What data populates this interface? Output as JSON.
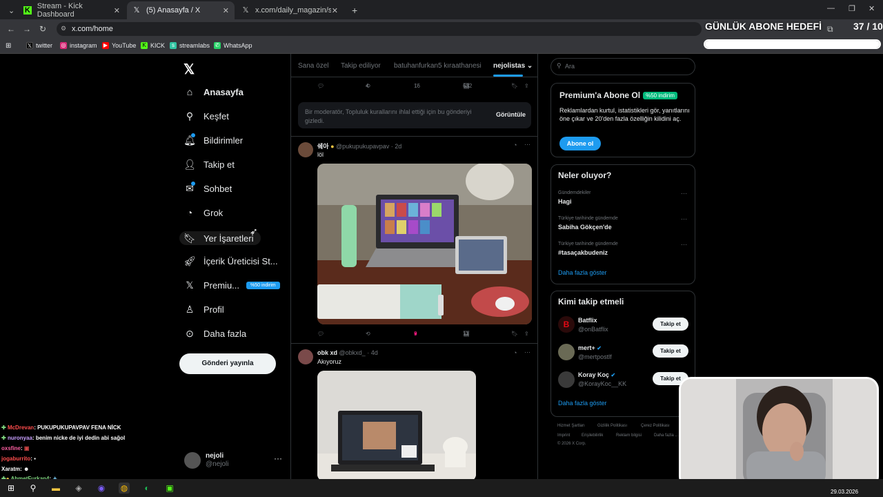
{
  "browser": {
    "tabs": [
      {
        "title": "Stream - Kick Dashboard"
      },
      {
        "title": "(5) Anasayfa / X"
      },
      {
        "title": "x.com/daily_magazin/status/20"
      }
    ],
    "url": "x.com/home",
    "bookmarks": [
      "twitter",
      "instagram",
      "YouTube",
      "KICK",
      "streamlabs",
      "WhatsApp"
    ]
  },
  "goal": {
    "title": "GÜNLÜK ABONE HEDEFİ",
    "count": "37 / 10",
    "progress": 1.0
  },
  "nav": {
    "home": "Anasayfa",
    "explore": "Keşfet",
    "notifications": "Bildirimler",
    "follow": "Takip et",
    "messages": "Sohbet",
    "grok": "Grok",
    "bookmarks": "Yer İşaretleri",
    "creator": "İçerik Üreticisi St...",
    "premium": "Premiu...",
    "premium_badge": "%50 indirim",
    "profile": "Profil",
    "more": "Daha fazla",
    "post_button": "Gönderi yayınla",
    "user_name": "nejoli",
    "user_handle": "@nejoli"
  },
  "timeline_tabs": [
    "Sana özel",
    "Takip ediliyor",
    "batuhanfurkan5 kıraathanesi",
    "nejolistas"
  ],
  "top_actions": {
    "retweets": "4",
    "likes": "16",
    "views": "682"
  },
  "moderation": {
    "text": "Bir moderatör, Topluluk kurallarını ihlal ettiği için bu gönderiyi gizledi.",
    "button": "Görüntüle"
  },
  "tweets": [
    {
      "name": "쉐아",
      "handle": "@pukupukupavpav",
      "time": "2d",
      "text": "löl",
      "likes": "3",
      "views": "11"
    },
    {
      "name": "obk xd",
      "handle": "@obkxd_",
      "time": "4d",
      "text": "Akıyoruz"
    }
  ],
  "search": {
    "placeholder": "Ara"
  },
  "premium": {
    "title": "Premium'a Abone Ol",
    "badge": "%50 indirim",
    "desc": "Reklamlardan kurtul, istatistikleri gör, yanıtlarını öne çıkar ve 20'den fazla özelliğin kilidini aç.",
    "button": "Abone ol"
  },
  "trends": {
    "title": "Neler oluyor?",
    "items": [
      {
        "context": "Gündemdekiler",
        "name": "Hagi"
      },
      {
        "context": "Türkiye tarihinde gündemde",
        "name": "Sabiha Gökçen'de"
      },
      {
        "context": "Türkiye tarihinde gündemde",
        "name": "#tasaçakbudeniz"
      }
    ],
    "show_more": "Daha fazla göster"
  },
  "who_to_follow": {
    "title": "Kimi takip etmeli",
    "items": [
      {
        "name": "Batflix",
        "handle": "@onBatflix",
        "button": "Takip et"
      },
      {
        "name": "mert+",
        "handle": "@mertpostlf",
        "button": "Takip et"
      },
      {
        "name": "Koray Koç",
        "handle": "@KorayKoc__KK",
        "button": "Takip et"
      }
    ],
    "show_more": "Daha fazla göster"
  },
  "footer": [
    "Hizmet Şartları",
    "Gizlilik Politikası",
    "Çerez Politikası",
    "Imprint",
    "Erişilebilirlik",
    "Reklam bilgisi",
    "Daha fazla ...",
    "© 2026 X Corp."
  ],
  "chat": [
    {
      "user": "McDrevan",
      "msg": ": PUKUPUKUPAVPAV FENA NİCK",
      "color": "#ff4d4d"
    },
    {
      "user": "nuronyaa",
      "msg": ": benim nicke de iyi dedin abi sağol",
      "color": "#c9a0ff"
    },
    {
      "user": "oxsfine",
      "msg": ":",
      "color": "#ff5fa2"
    },
    {
      "user": "jogaburrito",
      "msg": ":",
      "color": "#ff4d4d"
    },
    {
      "user": "Xaratm",
      "msg": ":",
      "color": "#ffffff"
    },
    {
      "user": "AhmetFurkan4",
      "msg": ":",
      "color": "#7fd67f"
    }
  ],
  "clock": "29.03.2026"
}
